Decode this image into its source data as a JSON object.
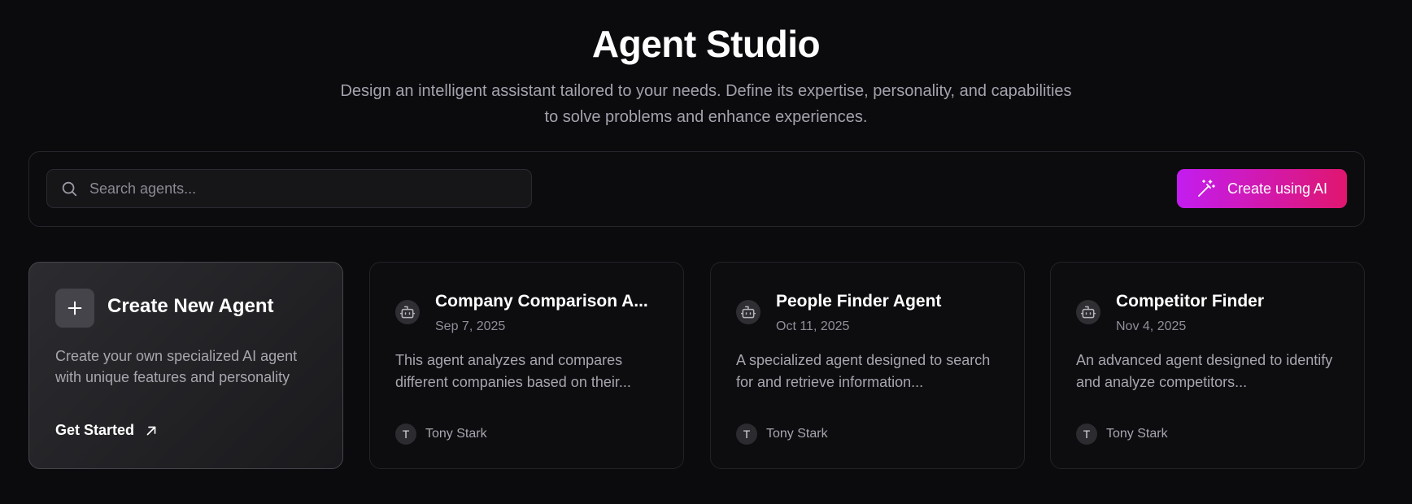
{
  "header": {
    "title": "Agent Studio",
    "subtitle": "Design an intelligent assistant tailored to your needs. Define its expertise, personality, and capabilities to solve problems and enhance experiences."
  },
  "toolbar": {
    "search_placeholder": "Search agents...",
    "create_ai_label": "Create using AI",
    "accent_gradient": [
      "#c31cf0",
      "#e0166f"
    ]
  },
  "create_card": {
    "title": "Create New Agent",
    "description": "Create your own specialized AI agent with unique features and personality",
    "cta": "Get Started",
    "icon": "plus-icon",
    "cta_icon": "arrow-up-right-icon"
  },
  "agents": [
    {
      "name": "Company Comparison A...",
      "date": "Sep 7, 2025",
      "description": "This agent analyzes and compares different companies based on their...",
      "author_initial": "T",
      "author": "Tony Stark",
      "icon": "bot-icon"
    },
    {
      "name": "People Finder Agent",
      "date": "Oct 11, 2025",
      "description": "A specialized agent designed to search for and retrieve information...",
      "author_initial": "T",
      "author": "Tony Stark",
      "icon": "bot-icon"
    },
    {
      "name": "Competitor Finder",
      "date": "Nov 4, 2025",
      "description": "An advanced agent designed to identify and analyze competitors...",
      "author_initial": "T",
      "author": "Tony Stark",
      "icon": "bot-icon"
    }
  ]
}
